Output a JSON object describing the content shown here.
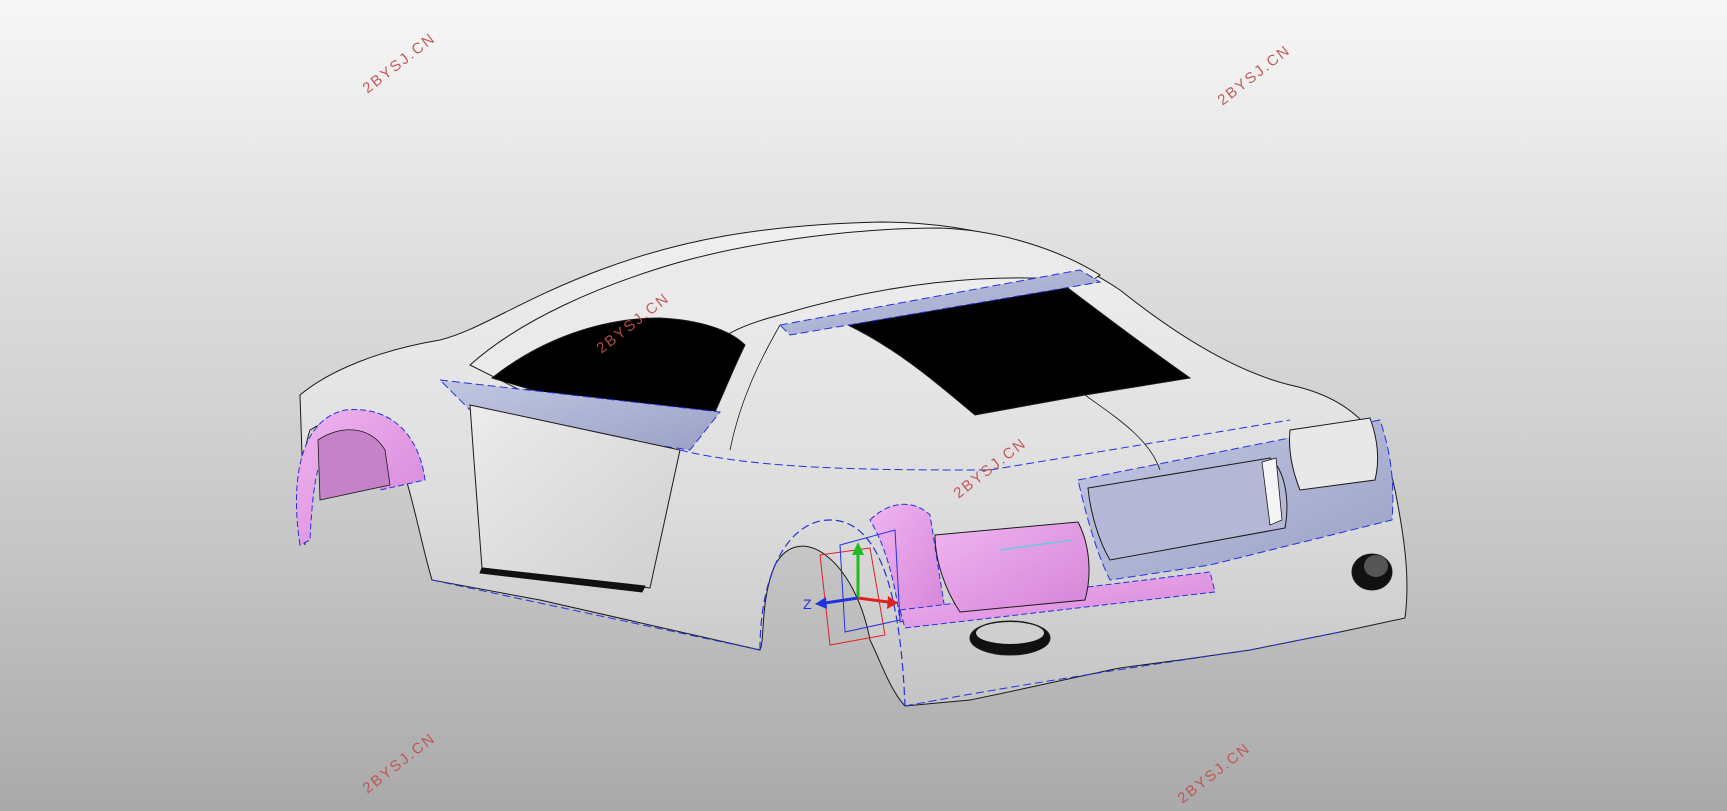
{
  "viewport": {
    "background_top": "#f7f7f7",
    "background_bottom": "#a9a9a9"
  },
  "model": {
    "body_color": "#e4e4e4",
    "glass_color": "#000000",
    "highlight_surface_color": "#e59ae8",
    "blue_surface_color": "#aab0d0",
    "edge_color": "#1a1a1a",
    "selection_edge_color": "#2233dd"
  },
  "triad": {
    "z_label": "Z",
    "x_axis_color": "#dd2222",
    "y_axis_color": "#22bb22",
    "z_axis_color": "#2233dd"
  },
  "watermarks": [
    {
      "text": "2BYSJ.CN"
    },
    {
      "text": "2BYSJ.CN"
    },
    {
      "text": "2BYSJ.CN"
    },
    {
      "text": "2BYSJ.CN"
    },
    {
      "text": "2BYSJ.CN"
    },
    {
      "text": "2BYSJ.CN"
    }
  ]
}
